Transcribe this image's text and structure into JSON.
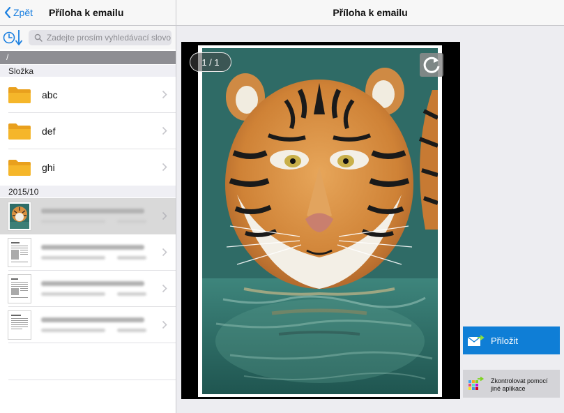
{
  "left_panel": {
    "back_label": "Zpět",
    "title": "Příloha k emailu",
    "search_placeholder": "Zadejte prosím vyhledávací slovo",
    "path": "/",
    "folders_header": "Složka",
    "folders": [
      {
        "name": "abc",
        "icon": "folder-icon"
      },
      {
        "name": "def",
        "icon": "folder-icon"
      },
      {
        "name": "ghi",
        "icon": "folder-icon"
      }
    ],
    "files_header": "2015/10",
    "files_count": 4
  },
  "right_panel": {
    "title": "Příloha k emailu",
    "page_counter": "1 / 1",
    "attach_label": "Přiložit",
    "other_app_label": "Zkontrolovat pomocí jiné aplikace"
  },
  "colors": {
    "accent": "#0f7ed6",
    "link": "#1a7fe0",
    "folder": "#f5b62a",
    "path_bar": "#8e8e93"
  },
  "icons": [
    "chevron-left-icon",
    "sort-history-icon",
    "search-icon",
    "folder-icon",
    "chevron-right-icon",
    "rotate-icon",
    "mail-attach-icon",
    "app-grid-icon"
  ]
}
